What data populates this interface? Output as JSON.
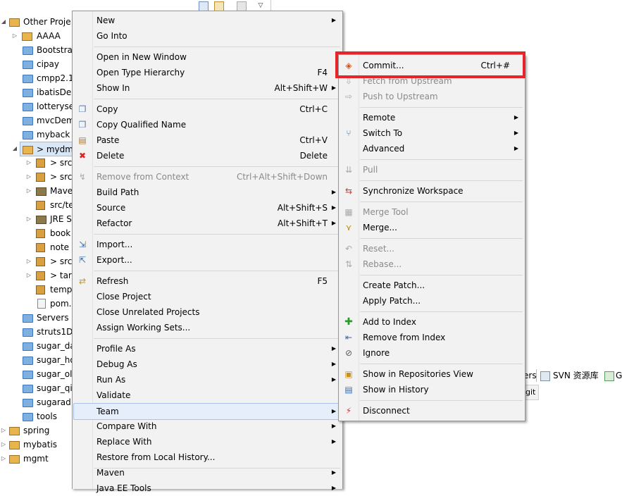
{
  "tree": {
    "items": [
      {
        "label": "Other Proje"
      },
      {
        "label": "AAAA"
      },
      {
        "label": "Bootstra"
      },
      {
        "label": "cipay"
      },
      {
        "label": "cmpp2.1"
      },
      {
        "label": "ibatisDer"
      },
      {
        "label": "lotteryse"
      },
      {
        "label": "mvcDem"
      },
      {
        "label": "myback"
      },
      {
        "label": "> mydm"
      },
      {
        "label": "> src"
      },
      {
        "label": "> src"
      },
      {
        "label": "Mave"
      },
      {
        "label": "src/te"
      },
      {
        "label": "JRE S"
      },
      {
        "label": "book"
      },
      {
        "label": "note"
      },
      {
        "label": "> src"
      },
      {
        "label": "> tar"
      },
      {
        "label": "temp"
      },
      {
        "label": "pom."
      },
      {
        "label": "Servers"
      },
      {
        "label": "struts1D"
      },
      {
        "label": "sugar_da"
      },
      {
        "label": "sugar_ho"
      },
      {
        "label": "sugar_ol"
      },
      {
        "label": "sugar_qi"
      },
      {
        "label": "sugarad"
      },
      {
        "label": "tools"
      },
      {
        "label": "spring"
      },
      {
        "label": "mybatis"
      },
      {
        "label": "mgmt"
      }
    ]
  },
  "tabs": {
    "servers_partial": "ers",
    "svn": "SVN 资源库",
    "git_partial": "G",
    "git_small": "git"
  },
  "context_menu": {
    "items": [
      {
        "label": "New",
        "shortcut": "",
        "submenu": true,
        "icon": "",
        "disabled": false
      },
      {
        "label": "Go Into",
        "shortcut": "",
        "submenu": false,
        "icon": "",
        "disabled": false
      },
      {
        "label": "Open in New Window",
        "shortcut": "",
        "submenu": false,
        "icon": "",
        "disabled": false
      },
      {
        "label": "Open Type Hierarchy",
        "shortcut": "F4",
        "submenu": false,
        "icon": "",
        "disabled": false
      },
      {
        "label": "Show In",
        "shortcut": "Alt+Shift+W",
        "submenu": true,
        "icon": "",
        "disabled": false
      },
      {
        "label": "Copy",
        "shortcut": "Ctrl+C",
        "submenu": false,
        "icon": "copy-icon",
        "disabled": false
      },
      {
        "label": "Copy Qualified Name",
        "shortcut": "",
        "submenu": false,
        "icon": "copy-qualified-icon",
        "disabled": false
      },
      {
        "label": "Paste",
        "shortcut": "Ctrl+V",
        "submenu": false,
        "icon": "paste-icon",
        "disabled": false
      },
      {
        "label": "Delete",
        "shortcut": "Delete",
        "submenu": false,
        "icon": "delete-icon",
        "disabled": false
      },
      {
        "label": "Remove from Context",
        "shortcut": "Ctrl+Alt+Shift+Down",
        "submenu": false,
        "icon": "remove-context-icon",
        "disabled": true
      },
      {
        "label": "Build Path",
        "shortcut": "",
        "submenu": true,
        "icon": "",
        "disabled": false
      },
      {
        "label": "Source",
        "shortcut": "Alt+Shift+S",
        "submenu": true,
        "icon": "",
        "disabled": false
      },
      {
        "label": "Refactor",
        "shortcut": "Alt+Shift+T",
        "submenu": true,
        "icon": "",
        "disabled": false
      },
      {
        "label": "Import...",
        "shortcut": "",
        "submenu": false,
        "icon": "import-icon",
        "disabled": false
      },
      {
        "label": "Export...",
        "shortcut": "",
        "submenu": false,
        "icon": "export-icon",
        "disabled": false
      },
      {
        "label": "Refresh",
        "shortcut": "F5",
        "submenu": false,
        "icon": "refresh-icon",
        "disabled": false
      },
      {
        "label": "Close Project",
        "shortcut": "",
        "submenu": false,
        "icon": "",
        "disabled": false
      },
      {
        "label": "Close Unrelated Projects",
        "shortcut": "",
        "submenu": false,
        "icon": "",
        "disabled": false
      },
      {
        "label": "Assign Working Sets...",
        "shortcut": "",
        "submenu": false,
        "icon": "",
        "disabled": false
      },
      {
        "label": "Profile As",
        "shortcut": "",
        "submenu": true,
        "icon": "",
        "disabled": false
      },
      {
        "label": "Debug As",
        "shortcut": "",
        "submenu": true,
        "icon": "",
        "disabled": false
      },
      {
        "label": "Run As",
        "shortcut": "",
        "submenu": true,
        "icon": "",
        "disabled": false
      },
      {
        "label": "Validate",
        "shortcut": "",
        "submenu": false,
        "icon": "",
        "disabled": false
      },
      {
        "label": "Team",
        "shortcut": "",
        "submenu": true,
        "icon": "",
        "disabled": false,
        "highlighted": true
      },
      {
        "label": "Compare With",
        "shortcut": "",
        "submenu": true,
        "icon": "",
        "disabled": false
      },
      {
        "label": "Replace With",
        "shortcut": "",
        "submenu": true,
        "icon": "",
        "disabled": false
      },
      {
        "label": "Restore from Local History...",
        "shortcut": "",
        "submenu": false,
        "icon": "",
        "disabled": false
      },
      {
        "label": "Maven",
        "shortcut": "",
        "submenu": true,
        "icon": "",
        "disabled": false
      },
      {
        "label": "Java EE Tools",
        "shortcut": "",
        "submenu": true,
        "icon": "",
        "disabled": false
      }
    ]
  },
  "team_menu": {
    "items": [
      {
        "label": "Commit...",
        "shortcut": "Ctrl+#",
        "submenu": false,
        "icon": "commit-icon",
        "disabled": false
      },
      {
        "label": "Fetch from Upstream",
        "shortcut": "",
        "submenu": false,
        "icon": "fetch-icon",
        "disabled": true
      },
      {
        "label": "Push to Upstream",
        "shortcut": "",
        "submenu": false,
        "icon": "push-icon",
        "disabled": true
      },
      {
        "label": "Remote",
        "shortcut": "",
        "submenu": true,
        "icon": "",
        "disabled": false
      },
      {
        "label": "Switch To",
        "shortcut": "",
        "submenu": true,
        "icon": "switch-branch-icon",
        "disabled": false
      },
      {
        "label": "Advanced",
        "shortcut": "",
        "submenu": true,
        "icon": "",
        "disabled": false
      },
      {
        "label": "Pull",
        "shortcut": "",
        "submenu": false,
        "icon": "pull-icon",
        "disabled": true
      },
      {
        "label": "Synchronize Workspace",
        "shortcut": "",
        "submenu": false,
        "icon": "synchronize-icon",
        "disabled": false
      },
      {
        "label": "Merge Tool",
        "shortcut": "",
        "submenu": false,
        "icon": "merge-tool-icon",
        "disabled": true
      },
      {
        "label": "Merge...",
        "shortcut": "",
        "submenu": false,
        "icon": "merge-icon",
        "disabled": false
      },
      {
        "label": "Reset...",
        "shortcut": "",
        "submenu": false,
        "icon": "reset-icon",
        "disabled": true
      },
      {
        "label": "Rebase...",
        "shortcut": "",
        "submenu": false,
        "icon": "rebase-icon",
        "disabled": true
      },
      {
        "label": "Create Patch...",
        "shortcut": "",
        "submenu": false,
        "icon": "",
        "disabled": false
      },
      {
        "label": "Apply Patch...",
        "shortcut": "",
        "submenu": false,
        "icon": "",
        "disabled": false
      },
      {
        "label": "Add to Index",
        "shortcut": "",
        "submenu": false,
        "icon": "add-index-icon",
        "disabled": false
      },
      {
        "label": "Remove from Index",
        "shortcut": "",
        "submenu": false,
        "icon": "remove-index-icon",
        "disabled": false
      },
      {
        "label": "Ignore",
        "shortcut": "",
        "submenu": false,
        "icon": "ignore-icon",
        "disabled": false
      },
      {
        "label": "Show in Repositories View",
        "shortcut": "",
        "submenu": false,
        "icon": "git-repositories-icon",
        "disabled": false
      },
      {
        "label": "Show in History",
        "shortcut": "",
        "submenu": false,
        "icon": "history-icon",
        "disabled": false
      },
      {
        "label": "Disconnect",
        "shortcut": "",
        "submenu": false,
        "icon": "disconnect-icon",
        "disabled": false
      }
    ]
  },
  "colors": {
    "highlight_box": "#e8242a",
    "menu_background": "#f2f2f2",
    "selection": "#e5eefa"
  }
}
